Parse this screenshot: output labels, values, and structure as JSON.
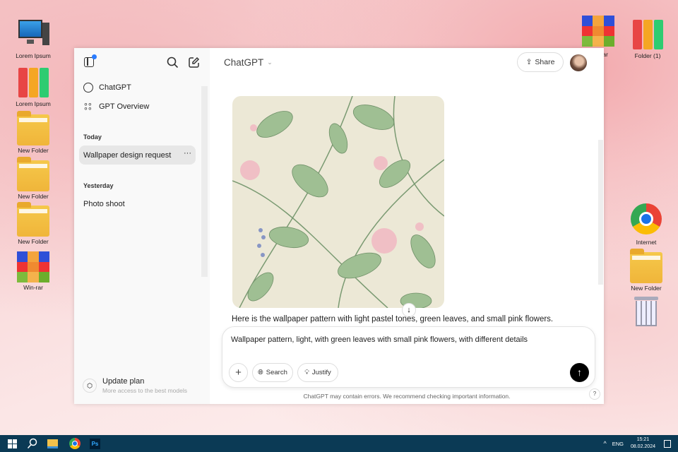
{
  "desktop": {
    "left_icons": [
      {
        "label": "Lorem Ipsum",
        "type": "computer"
      },
      {
        "label": "Lorem Ipsum",
        "type": "binders"
      },
      {
        "label": "New Folder",
        "type": "folder"
      },
      {
        "label": "New Folder",
        "type": "folder"
      },
      {
        "label": "New Folder",
        "type": "folder"
      },
      {
        "label": "Win-rar",
        "type": "rar"
      }
    ],
    "right_icons": [
      {
        "label": "Win-rar",
        "type": "rar"
      },
      {
        "label": "Folder (1)",
        "type": "binders"
      },
      {
        "label": "Internet",
        "type": "chrome"
      },
      {
        "label": "New Folder",
        "type": "folder"
      },
      {
        "label": "",
        "type": "recycle-bin"
      }
    ]
  },
  "sidebar": {
    "nav": [
      {
        "label": "ChatGPT",
        "icon": "openai-logo-icon"
      },
      {
        "label": "GPT Overview",
        "icon": "grid-icon"
      }
    ],
    "sections": [
      {
        "title": "Today",
        "items": [
          "Wallpaper design request"
        ]
      },
      {
        "title": "Yesterday",
        "items": [
          "Photo shoot"
        ]
      }
    ],
    "update": {
      "title": "Update plan",
      "subtitle": "More access to the best models"
    }
  },
  "header": {
    "model": "ChatGPT",
    "share": "Share"
  },
  "chat": {
    "response": "Here is the wallpaper pattern with light pastel tones, green leaves, and small pink flowers."
  },
  "composer": {
    "value": "Wallpaper pattern, light, with green leaves with small pink flowers, with different details",
    "search": "Search",
    "justify": "Justify"
  },
  "footer": {
    "disclaimer": "ChatGPT may contain errors. We recommend checking important information.",
    "help": "?"
  },
  "taskbar": {
    "lang": "ENG",
    "time": "15:21",
    "date": "08.02.2024"
  },
  "colors": {
    "accent_dot": "#2b7cff",
    "taskbar": "#0b3a55",
    "send_button": "#000000"
  }
}
